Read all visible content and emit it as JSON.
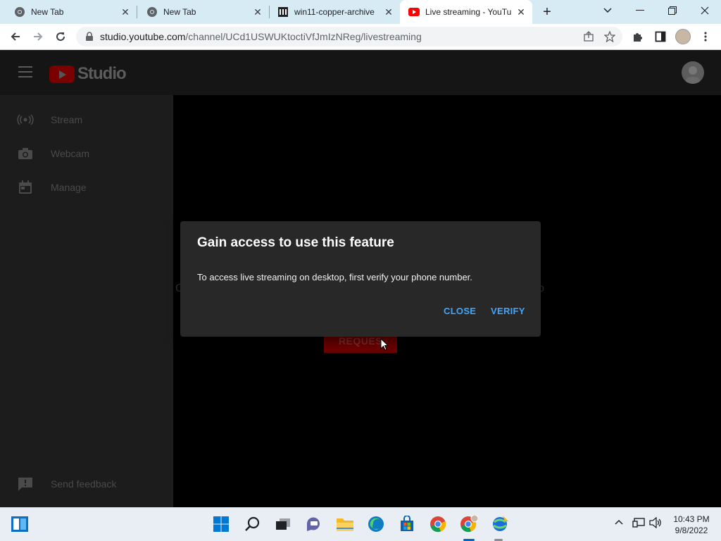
{
  "browser": {
    "tabs": [
      {
        "title": "New Tab",
        "favicon": "chrome-icon"
      },
      {
        "title": "New Tab",
        "favicon": "chrome-icon"
      },
      {
        "title": "win11-copper-archive",
        "favicon": "archive-icon"
      },
      {
        "title": "Live streaming - YouTu",
        "favicon": "youtube-icon",
        "active": true
      }
    ],
    "address": {
      "domain": "studio.youtube.com",
      "path": "/channel/UCd1USWUKtoctiVfJmIzNReg/livestreaming"
    }
  },
  "studio": {
    "logo_text": "Studio",
    "sidebar": {
      "items": [
        {
          "label": "Stream",
          "icon": "broadcast-icon"
        },
        {
          "label": "Webcam",
          "icon": "camera-icon"
        },
        {
          "label": "Manage",
          "icon": "calendar-icon"
        }
      ],
      "feedback_label": "Send feedback"
    },
    "request_button_label": "REQUES",
    "background_left_char": "C",
    "background_right_char": "o"
  },
  "dialog": {
    "title": "Gain access to use this feature",
    "body": "To access live streaming on desktop, first verify your phone number.",
    "close_label": "CLOSE",
    "verify_label": "VERIFY"
  },
  "taskbar": {
    "time": "10:43 PM",
    "date": "9/8/2022"
  },
  "colors": {
    "accent": "#3ea6ff",
    "dialog_bg": "#282828",
    "tabstrip_bg": "#d7ebf5"
  }
}
